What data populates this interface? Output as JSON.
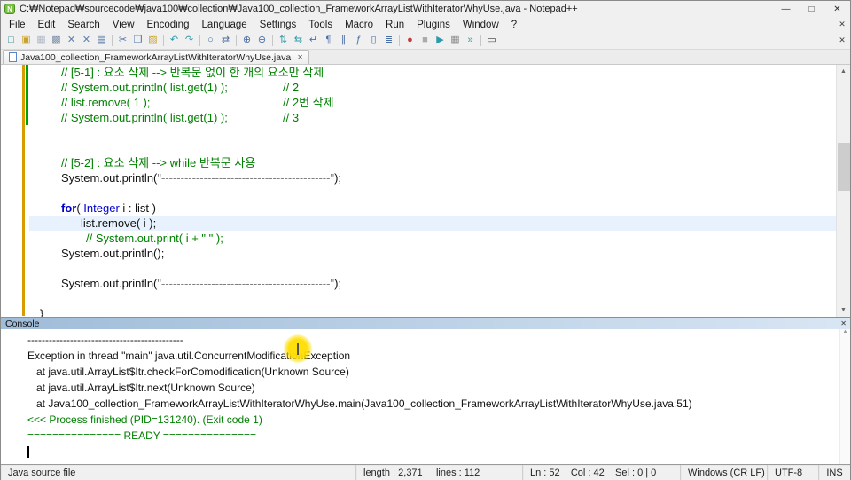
{
  "colors": {
    "comment": "#008000",
    "keyword": "#0000d0",
    "string": "#808080",
    "console-ok": "#008000",
    "curline": "#e8f2fe",
    "changebar": "#d89b00",
    "changebar-saved": "#00a000"
  },
  "window": {
    "title": "C:₩Notepad₩sourcecode₩java100₩collection₩Java100_collection_FrameworkArrayListWithIteratorWhyUse.java - Notepad++",
    "app_initial": "N",
    "controls": {
      "minimize": "—",
      "maximize": "□",
      "close": "✕"
    }
  },
  "menubar": {
    "items": [
      "File",
      "Edit",
      "Search",
      "View",
      "Encoding",
      "Language",
      "Settings",
      "Tools",
      "Macro",
      "Run",
      "Plugins",
      "Window",
      "?"
    ],
    "close": "✕"
  },
  "toolbar": {
    "icons": [
      {
        "name": "new-file",
        "glyph": "□",
        "color": "#1f7f8f"
      },
      {
        "name": "open-folder",
        "glyph": "▣",
        "color": "#c9a227"
      },
      {
        "name": "save",
        "glyph": "▦",
        "color": "#b0b8c4"
      },
      {
        "name": "save-all",
        "glyph": "▩",
        "color": "#7a8ba6"
      },
      {
        "name": "close-document",
        "glyph": "✕",
        "color": "#5a7fae"
      },
      {
        "name": "close-all",
        "glyph": "✕",
        "color": "#5a7fae"
      },
      {
        "name": "print",
        "glyph": "▤",
        "color": "#4a6fa5"
      },
      {
        "sep": true
      },
      {
        "name": "cut",
        "glyph": "✂",
        "color": "#4a6fa5"
      },
      {
        "name": "copy",
        "glyph": "❐",
        "color": "#4a6fa5"
      },
      {
        "name": "paste",
        "glyph": "▨",
        "color": "#c9a227"
      },
      {
        "sep": true
      },
      {
        "name": "undo",
        "glyph": "↶",
        "color": "#2e9aa8"
      },
      {
        "name": "redo",
        "glyph": "↷",
        "color": "#2e9aa8"
      },
      {
        "sep": true
      },
      {
        "name": "find",
        "glyph": "○",
        "color": "#4a6fa5"
      },
      {
        "name": "replace",
        "glyph": "⇄",
        "color": "#4a6fa5"
      },
      {
        "sep": true
      },
      {
        "name": "zoom-in",
        "glyph": "⊕",
        "color": "#4a6fa5"
      },
      {
        "name": "zoom-out",
        "glyph": "⊖",
        "color": "#4a6fa5"
      },
      {
        "sep": true
      },
      {
        "name": "sync-scroll-vertical",
        "glyph": "⇅",
        "color": "#2e9aa8"
      },
      {
        "name": "sync-scroll-horizontal",
        "glyph": "⇆",
        "color": "#2e9aa8"
      },
      {
        "name": "word-wrap",
        "glyph": "↵",
        "color": "#4a6fa5"
      },
      {
        "name": "show-all-characters",
        "glyph": "¶",
        "color": "#4a6fa5"
      },
      {
        "name": "indent-guide",
        "glyph": "∥",
        "color": "#4a6fa5"
      },
      {
        "name": "function-list",
        "glyph": "ƒ",
        "color": "#4a6fa5"
      },
      {
        "name": "document-map",
        "glyph": "▯",
        "color": "#4a6fa5"
      },
      {
        "name": "document-list",
        "glyph": "≣",
        "color": "#4a6fa5"
      },
      {
        "sep": true
      },
      {
        "name": "record-macro",
        "glyph": "●",
        "color": "#c23b3b"
      },
      {
        "name": "stop-macro",
        "glyph": "■",
        "color": "#aaaaaa"
      },
      {
        "name": "play-macro",
        "glyph": "▶",
        "color": "#2e9aa8"
      },
      {
        "name": "save-macro",
        "glyph": "▦",
        "color": "#8b8b8b"
      },
      {
        "name": "run-macro-multiple",
        "glyph": "»",
        "color": "#2e9aa8"
      },
      {
        "sep": true
      },
      {
        "name": "nppexec-console",
        "glyph": "▭",
        "color": "#333333"
      }
    ]
  },
  "tabs": [
    {
      "label": "Java100_collection_FrameworkArrayListWithIteratorWhyUse.java",
      "close": "✕",
      "active": true
    }
  ],
  "editor": {
    "lines": [
      {
        "ind": "a",
        "segs": [
          {
            "c": "cmt",
            "t": "// [5-1] : 요소 삭제 --> 반복문 없이 한 개의 요소만 삭제"
          }
        ]
      },
      {
        "ind": "a",
        "segs": [
          {
            "c": "cmt",
            "t": "// System.out.println( list.get(1) );"
          }
        ],
        "tail": "// 2"
      },
      {
        "ind": "a",
        "segs": [
          {
            "c": "cmt",
            "t": "// list.remove( 1 );"
          }
        ],
        "tail": "// 2번 삭제"
      },
      {
        "ind": "a",
        "segs": [
          {
            "c": "cmt",
            "t": "// System.out.println( list.get(1) );"
          }
        ],
        "tail": "// 3"
      },
      {
        "ind": "0",
        "segs": []
      },
      {
        "ind": "0",
        "segs": []
      },
      {
        "ind": "a",
        "segs": [
          {
            "c": "cmt",
            "t": "// [5-2] : 요소 삭제 --> while 반복문 사용"
          }
        ]
      },
      {
        "ind": "a",
        "segs": [
          {
            "c": "pln",
            "t": "System.out.println("
          },
          {
            "c": "str",
            "t": "\"--------------------------------------------\""
          },
          {
            "c": "pln",
            "t": ");"
          }
        ]
      },
      {
        "ind": "0",
        "segs": []
      },
      {
        "ind": "a",
        "segs": [
          {
            "c": "kw",
            "t": "for"
          },
          {
            "c": "pln",
            "t": "( "
          },
          {
            "c": "kw2",
            "t": "Integer"
          },
          {
            "c": "pln",
            "t": " i : list )"
          }
        ]
      },
      {
        "ind": "b",
        "hl": true,
        "segs": [
          {
            "c": "pln",
            "t": "list.remove( i );"
          }
        ]
      },
      {
        "ind": "c",
        "segs": [
          {
            "c": "cmt",
            "t": "// System.out.print( i + \" \" );"
          }
        ]
      },
      {
        "ind": "a",
        "segs": [
          {
            "c": "pln",
            "t": "System.out.println();"
          }
        ]
      },
      {
        "ind": "0",
        "segs": []
      },
      {
        "ind": "a",
        "segs": [
          {
            "c": "pln",
            "t": "System.out.println("
          },
          {
            "c": "str",
            "t": "\"--------------------------------------------\""
          },
          {
            "c": "pln",
            "t": ");"
          }
        ]
      },
      {
        "ind": "0",
        "segs": []
      },
      {
        "ind": "d",
        "segs": [
          {
            "c": "pln",
            "t": "}"
          }
        ]
      }
    ]
  },
  "console": {
    "title": "Console",
    "close": "✕",
    "lines": [
      {
        "c": "out",
        "t": "--------------------------------------------"
      },
      {
        "c": "out",
        "t": "Exception in thread \"main\" java.util.ConcurrentModificationException"
      },
      {
        "c": "out",
        "t": "   at java.util.ArrayList$Itr.checkForComodification(Unknown Source)"
      },
      {
        "c": "out",
        "t": "   at java.util.ArrayList$Itr.next(Unknown Source)"
      },
      {
        "c": "out",
        "t": "   at Java100_collection_FrameworkArrayListWithIteratorWhyUse.main(Java100_collection_FrameworkArrayListWithIteratorWhyUse.java:51)"
      },
      {
        "c": "ok",
        "t": "<<< Process finished (PID=131240). (Exit code 1)"
      },
      {
        "c": "ok",
        "t": "=============== READY ==============="
      },
      {
        "c": "out",
        "t": "",
        "caret": true
      }
    ]
  },
  "statusbar": {
    "doc_type": "Java source file",
    "length_lines": "length : 2,371     lines : 112",
    "position": "Ln : 52    Col : 42    Sel : 0 | 0",
    "eol": "Windows (CR LF)",
    "encoding": "UTF-8",
    "mode": "INS"
  },
  "scrollbar": {
    "up": "▲",
    "down": "▼"
  }
}
